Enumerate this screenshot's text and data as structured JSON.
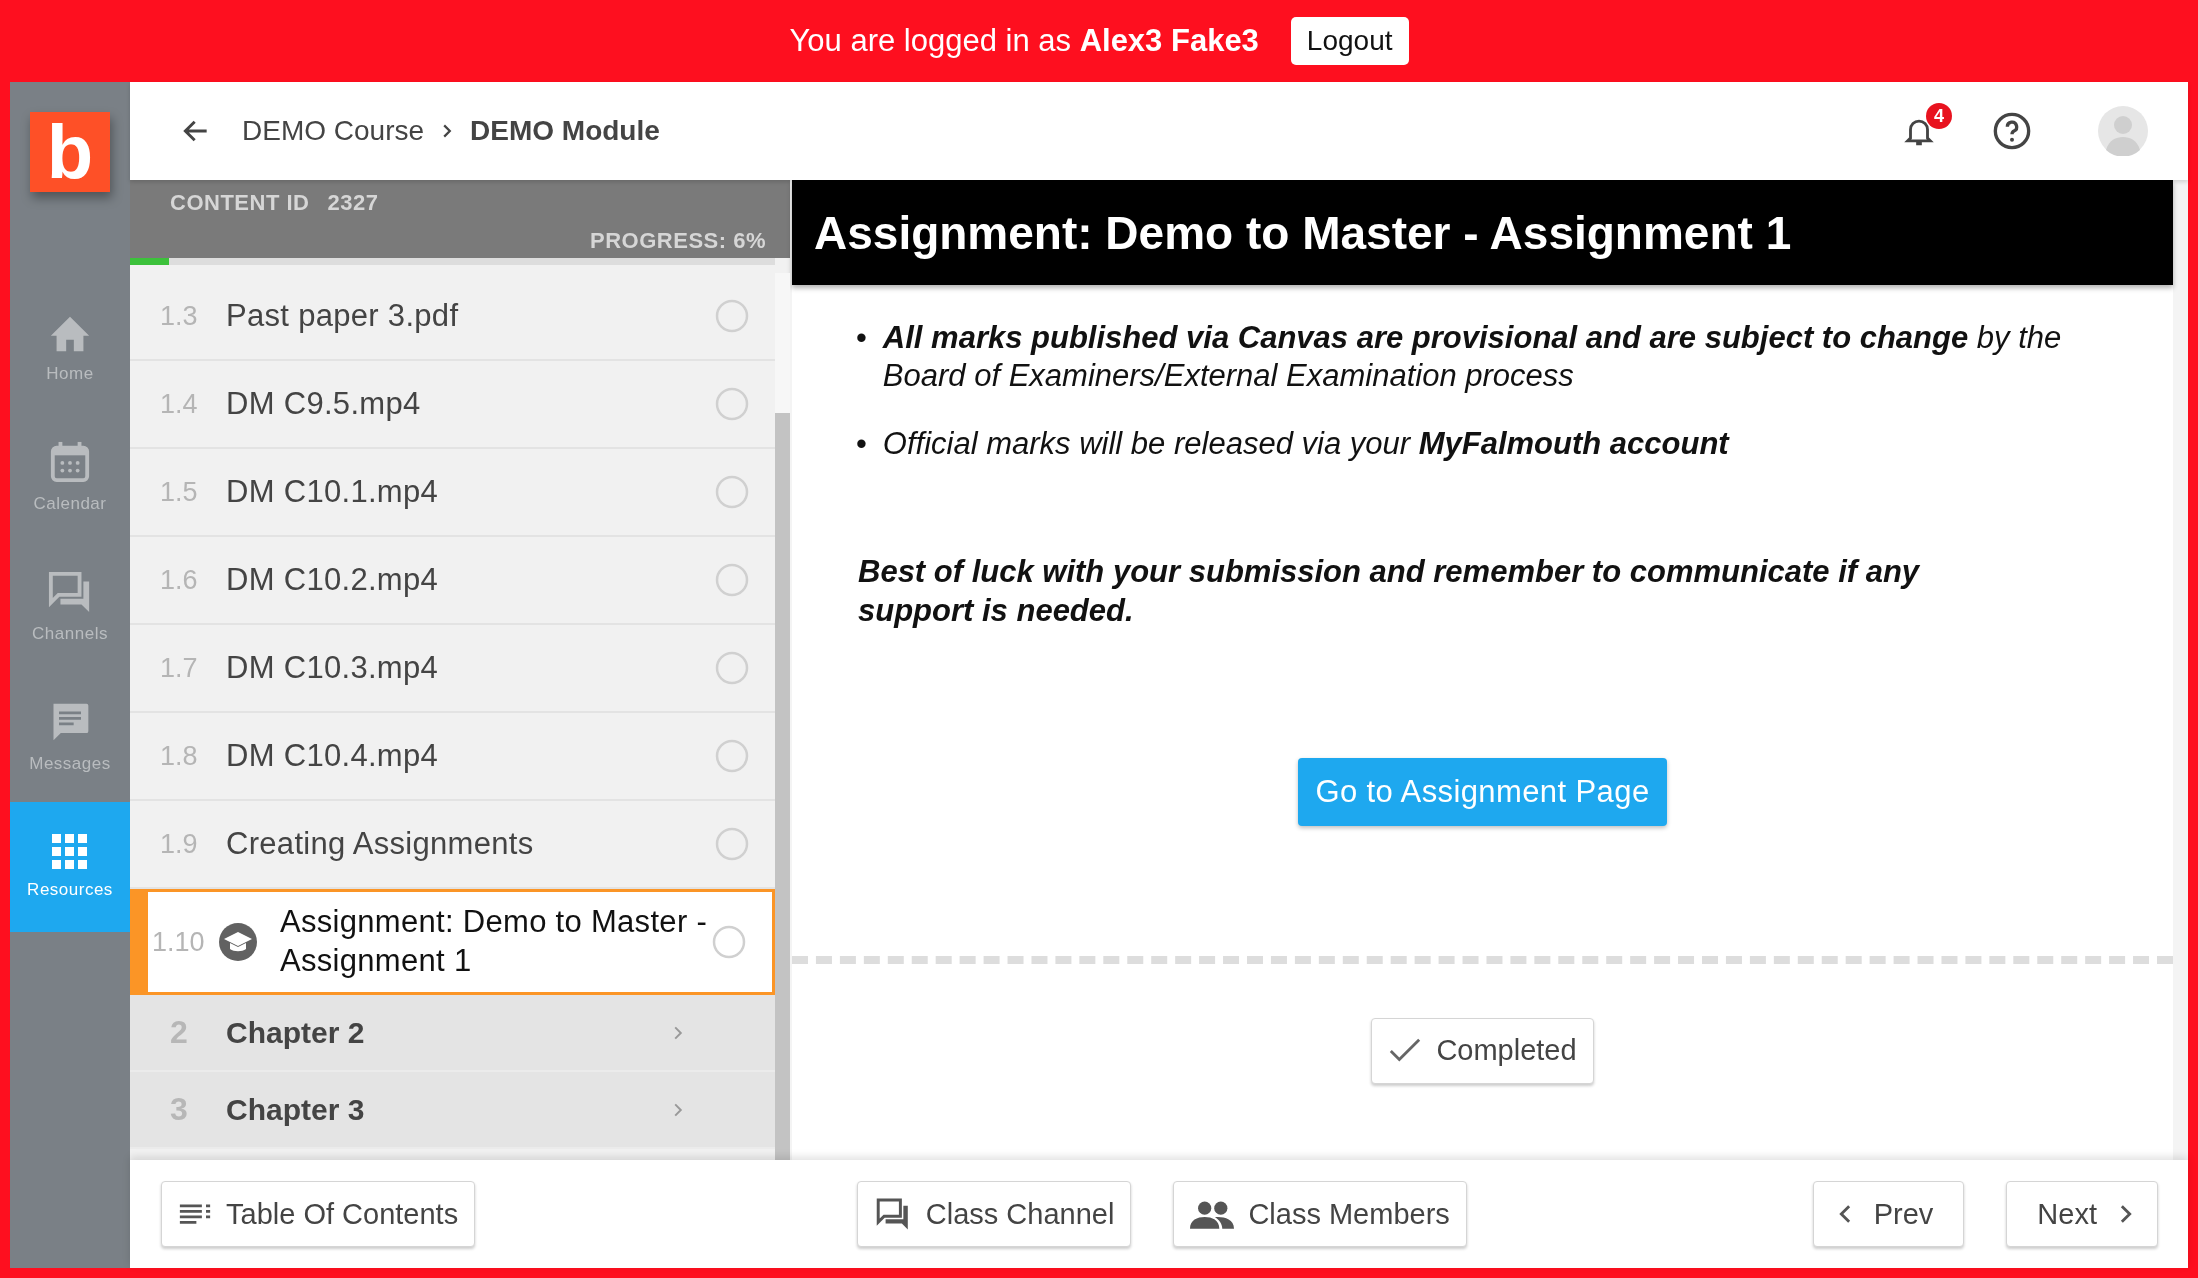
{
  "banner": {
    "prefix": "You are logged in as",
    "user": "Alex3 Fake3",
    "logout": "Logout"
  },
  "logo": {
    "letter": "b"
  },
  "nav": [
    {
      "label": "Home",
      "selected": false
    },
    {
      "label": "Calendar",
      "selected": false
    },
    {
      "label": "Channels",
      "selected": false
    },
    {
      "label": "Messages",
      "selected": false
    },
    {
      "label": "Resources",
      "selected": true
    }
  ],
  "header": {
    "breadcrumb": "DEMO Course",
    "current": "DEMO Module",
    "notifications": "4"
  },
  "toc": {
    "content_id_label": "CONTENT ID",
    "content_id": "2327",
    "progress": "PROGRESS: 6%",
    "level": 0.06,
    "items": [
      {
        "number": "1.3",
        "title": "Past paper 3.pdf",
        "kind": "file",
        "selected": false,
        "completed": false
      },
      {
        "number": "1.4",
        "title": "DM C9.5.mp4",
        "kind": "file",
        "selected": false,
        "completed": false
      },
      {
        "number": "1.5",
        "title": "DM C10.1.mp4",
        "kind": "file",
        "selected": false,
        "completed": false
      },
      {
        "number": "1.6",
        "title": "DM C10.2.mp4",
        "kind": "file",
        "selected": false,
        "completed": false
      },
      {
        "number": "1.7",
        "title": "DM C10.3.mp4",
        "kind": "file",
        "selected": false,
        "completed": false
      },
      {
        "number": "1.8",
        "title": "DM C10.4.mp4",
        "kind": "file",
        "selected": false,
        "completed": false
      },
      {
        "number": "1.9",
        "title": "Creating Assignments",
        "kind": "file",
        "selected": false,
        "completed": false
      },
      {
        "number": "1.10",
        "title": "Assignment: Demo to Master - Assignment 1",
        "kind": "assignment",
        "selected": true,
        "completed": false
      }
    ],
    "chapters": [
      {
        "number": "2",
        "title": "Chapter 2"
      },
      {
        "number": "3",
        "title": "Chapter 3"
      }
    ]
  },
  "content": {
    "title": "Assignment: Demo to Master - Assignment 1",
    "bullets": [
      {
        "marker": "•",
        "text": "**All marks published via Canvas are provisional and are subject to change** by the Board of Examiners/External Examination process"
      },
      {
        "marker": "•",
        "text": "Official marks will be released via your **MyFalmouth account**"
      }
    ],
    "closing": "Best of luck with your submission and remember to communicate if any support is needed.",
    "action": "Go to Assignment Page",
    "completed": "Completed"
  },
  "footer": {
    "toc": "Table Of Contents",
    "channel": "Class Channel",
    "members": "Class Members",
    "prev": "Prev",
    "next": "Next"
  }
}
